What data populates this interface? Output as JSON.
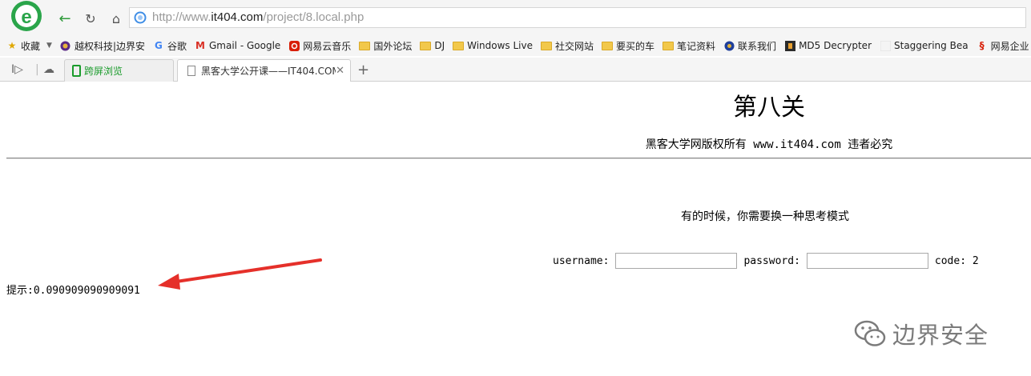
{
  "browser": {
    "url_prefix": "http://www.",
    "url_host": "it404.com",
    "url_path": "/project/8.local.php"
  },
  "bookmarks": [
    {
      "label": "收藏",
      "icon": "star-icon"
    },
    {
      "label": "越权科技|边界安",
      "icon": "site-icon"
    },
    {
      "label": "谷歌",
      "icon": "google-icon"
    },
    {
      "label": "Gmail - Google",
      "icon": "gmail-icon"
    },
    {
      "label": "网易云音乐",
      "icon": "netease-music-icon"
    },
    {
      "label": "国外论坛",
      "icon": "folder-icon"
    },
    {
      "label": "DJ",
      "icon": "folder-icon"
    },
    {
      "label": "Windows Live",
      "icon": "folder-icon"
    },
    {
      "label": "社交网站",
      "icon": "folder-icon"
    },
    {
      "label": "要买的车",
      "icon": "folder-icon"
    },
    {
      "label": "笔记资料",
      "icon": "folder-icon"
    },
    {
      "label": "联系我们",
      "icon": "globe-icon"
    },
    {
      "label": "MD5 Decrypter",
      "icon": "site-icon"
    },
    {
      "label": "Staggering Bea",
      "icon": "site-icon"
    },
    {
      "label": "网易企业",
      "icon": "netease-icon"
    }
  ],
  "tabs": {
    "tab1_label": "跨屏浏览",
    "tab2_label": "黑客大学公开课——IT404.COM"
  },
  "page": {
    "title": "第八关",
    "copyright": "黑客大学网版权所有 www.it404.com 违者必究",
    "hint": "有的时候，你需要换一种思考模式",
    "username_label": "username:",
    "password_label": "password:",
    "code_label": "code: 2",
    "tip": "提示:0.090909090909091"
  },
  "watermark": {
    "text": "边界安全"
  },
  "colors": {
    "accent_green": "#2e9a3a",
    "arrow_red": "#e5302a"
  }
}
